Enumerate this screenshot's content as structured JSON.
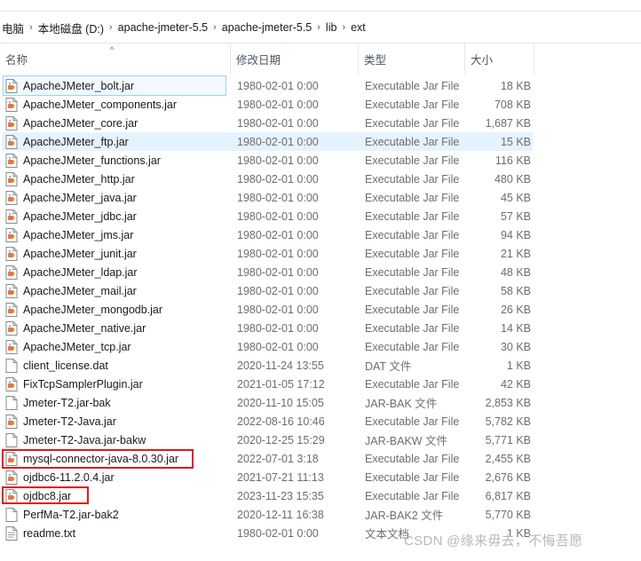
{
  "breadcrumb": [
    {
      "label": "电脑"
    },
    {
      "label": "本地磁盘 (D:)"
    },
    {
      "label": "apache-jmeter-5.5"
    },
    {
      "label": "apache-jmeter-5.5"
    },
    {
      "label": "lib"
    },
    {
      "label": "ext"
    }
  ],
  "columns": {
    "name": "名称",
    "date": "修改日期",
    "type": "类型",
    "size": "大小"
  },
  "files": [
    {
      "name": "ApacheJMeter_bolt.jar",
      "date": "1980-02-01 0:00",
      "type": "Executable Jar File",
      "size": "18 KB",
      "icon": "jar-file-icon"
    },
    {
      "name": "ApacheJMeter_components.jar",
      "date": "1980-02-01 0:00",
      "type": "Executable Jar File",
      "size": "708 KB",
      "icon": "jar-file-icon"
    },
    {
      "name": "ApacheJMeter_core.jar",
      "date": "1980-02-01 0:00",
      "type": "Executable Jar File",
      "size": "1,687 KB",
      "icon": "jar-file-icon"
    },
    {
      "name": "ApacheJMeter_ftp.jar",
      "date": "1980-02-01 0:00",
      "type": "Executable Jar File",
      "size": "15 KB",
      "icon": "jar-file-icon"
    },
    {
      "name": "ApacheJMeter_functions.jar",
      "date": "1980-02-01 0:00",
      "type": "Executable Jar File",
      "size": "116 KB",
      "icon": "jar-file-icon"
    },
    {
      "name": "ApacheJMeter_http.jar",
      "date": "1980-02-01 0:00",
      "type": "Executable Jar File",
      "size": "480 KB",
      "icon": "jar-file-icon"
    },
    {
      "name": "ApacheJMeter_java.jar",
      "date": "1980-02-01 0:00",
      "type": "Executable Jar File",
      "size": "45 KB",
      "icon": "jar-file-icon"
    },
    {
      "name": "ApacheJMeter_jdbc.jar",
      "date": "1980-02-01 0:00",
      "type": "Executable Jar File",
      "size": "57 KB",
      "icon": "jar-file-icon"
    },
    {
      "name": "ApacheJMeter_jms.jar",
      "date": "1980-02-01 0:00",
      "type": "Executable Jar File",
      "size": "94 KB",
      "icon": "jar-file-icon"
    },
    {
      "name": "ApacheJMeter_junit.jar",
      "date": "1980-02-01 0:00",
      "type": "Executable Jar File",
      "size": "21 KB",
      "icon": "jar-file-icon"
    },
    {
      "name": "ApacheJMeter_ldap.jar",
      "date": "1980-02-01 0:00",
      "type": "Executable Jar File",
      "size": "48 KB",
      "icon": "jar-file-icon"
    },
    {
      "name": "ApacheJMeter_mail.jar",
      "date": "1980-02-01 0:00",
      "type": "Executable Jar File",
      "size": "58 KB",
      "icon": "jar-file-icon"
    },
    {
      "name": "ApacheJMeter_mongodb.jar",
      "date": "1980-02-01 0:00",
      "type": "Executable Jar File",
      "size": "26 KB",
      "icon": "jar-file-icon"
    },
    {
      "name": "ApacheJMeter_native.jar",
      "date": "1980-02-01 0:00",
      "type": "Executable Jar File",
      "size": "14 KB",
      "icon": "jar-file-icon"
    },
    {
      "name": "ApacheJMeter_tcp.jar",
      "date": "1980-02-01 0:00",
      "type": "Executable Jar File",
      "size": "30 KB",
      "icon": "jar-file-icon"
    },
    {
      "name": "client_license.dat",
      "date": "2020-11-24 13:55",
      "type": "DAT 文件",
      "size": "1 KB",
      "icon": "blank-file-icon"
    },
    {
      "name": "FixTcpSamplerPlugin.jar",
      "date": "2021-01-05 17:12",
      "type": "Executable Jar File",
      "size": "42 KB",
      "icon": "jar-file-icon"
    },
    {
      "name": "Jmeter-T2.jar-bak",
      "date": "2020-11-10 15:05",
      "type": "JAR-BAK 文件",
      "size": "2,853 KB",
      "icon": "blank-file-icon"
    },
    {
      "name": "Jmeter-T2-Java.jar",
      "date": "2022-08-16 10:46",
      "type": "Executable Jar File",
      "size": "5,782 KB",
      "icon": "jar-file-icon"
    },
    {
      "name": "Jmeter-T2-Java.jar-bakw",
      "date": "2020-12-25 15:29",
      "type": "JAR-BAKW 文件",
      "size": "5,771 KB",
      "icon": "blank-file-icon"
    },
    {
      "name": "mysql-connector-java-8.0.30.jar",
      "date": "2022-07-01 3:18",
      "type": "Executable Jar File",
      "size": "2,455 KB",
      "icon": "jar-file-icon"
    },
    {
      "name": "ojdbc6-11.2.0.4.jar",
      "date": "2021-07-21 11:13",
      "type": "Executable Jar File",
      "size": "2,676 KB",
      "icon": "jar-file-icon"
    },
    {
      "name": "ojdbc8.jar",
      "date": "2023-11-23 15:35",
      "type": "Executable Jar File",
      "size": "6,817 KB",
      "icon": "jar-file-icon"
    },
    {
      "name": "PerfMa-T2.jar-bak2",
      "date": "2020-12-11 16:38",
      "type": "JAR-BAK2 文件",
      "size": "5,770 KB",
      "icon": "blank-file-icon"
    },
    {
      "name": "readme.txt",
      "date": "1980-02-01 0:00",
      "type": "文本文档",
      "size": "1 KB",
      "icon": "text-file-icon"
    }
  ],
  "watermark": "CSDN @缘来毋去，不悔吾愿"
}
